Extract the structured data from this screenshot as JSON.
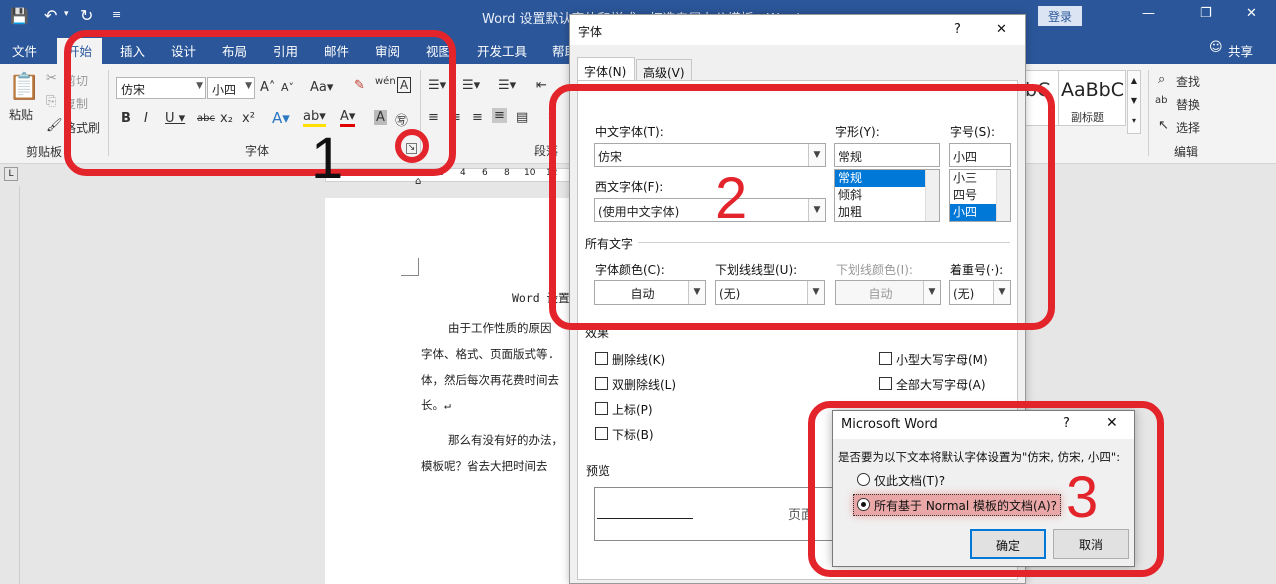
{
  "title": {
    "text": "Word  设置默认字体和样式，打造专属办公模板  -  Word",
    "login_label": "登录",
    "minimize_glyph": "—",
    "restore_glyph": "❐",
    "close_glyph": "✕"
  },
  "tabs": [
    "文件",
    "开始",
    "插入",
    "设计",
    "布局",
    "引用",
    "邮件",
    "审阅",
    "视图",
    "开发工具",
    "帮助"
  ],
  "share_label": "共享",
  "ribbon": {
    "clipboard": {
      "paste": "粘贴",
      "cut": "剪切",
      "copy": "复制",
      "painter": "格式刷",
      "group": "剪贴板"
    },
    "font": {
      "font_name": "仿宋",
      "font_size": "小四",
      "group": "字体"
    },
    "paragraph": {
      "group": "段落"
    },
    "styles": {
      "style1_preview": "AaBbC",
      "style1_name": "副标题",
      "style0_preview": "bC"
    },
    "editing": {
      "find": "查找",
      "replace": "替换",
      "select": "选择",
      "group": "编辑"
    }
  },
  "ruler": {
    "ticks": [
      "2",
      "4",
      "6",
      "8",
      "10",
      "12"
    ]
  },
  "document": {
    "heading": "Word 设置",
    "lines": [
      "由于工作性质的原因",
      "字体、格式、页面版式等.",
      "体，然后每次再花费时间去",
      "长。↵",
      "那么有没有好的办法，",
      "模板呢？省去大把时间去"
    ]
  },
  "font_dialog": {
    "title": "字体",
    "help": "?",
    "close": "✕",
    "tabs": [
      "字体(N)",
      "高级(V)"
    ],
    "chinese_font_label": "中文字体(T):",
    "chinese_font_value": "仿宋",
    "western_font_label": "西文字体(F):",
    "western_font_value": "(使用中文字体)",
    "style_label": "字形(Y):",
    "style_value": "常规",
    "style_options": [
      "常规",
      "倾斜",
      "加粗"
    ],
    "size_label": "字号(S):",
    "size_value": "小四",
    "size_options": [
      "小三",
      "四号",
      "小四"
    ],
    "all_text_label": "所有文字",
    "font_color_label": "字体颜色(C):",
    "font_color_value": "自动",
    "underline_style_label": "下划线线型(U):",
    "underline_style_value": "(无)",
    "underline_color_label": "下划线颜色(I):",
    "underline_color_value": "自动",
    "emphasis_label": "着重号(·):",
    "emphasis_value": "(无)",
    "effects_label": "效果",
    "effects_left": [
      "删除线(K)",
      "双删除线(L)",
      "上标(P)",
      "下标(B)"
    ],
    "effects_right": [
      "小型大写字母(M)",
      "全部大写字母(A)"
    ],
    "preview_label": "预览",
    "preview_text": "页面"
  },
  "ms_dialog": {
    "title": "Microsoft Word",
    "help": "?",
    "close": "✕",
    "question": "是否要为以下文本将默认字体设置为\"仿宋, 仿宋, 小四\":",
    "option1": "仅此文档(T)?",
    "option2": "所有基于 Normal 模板的文档(A)?",
    "ok": "确定",
    "cancel": "取消"
  },
  "annotations": [
    "1",
    "2",
    "3"
  ],
  "colors": {
    "ribbon_blue": "#2b579a",
    "highlight_red": "#e3242b",
    "selection_blue": "#0078d7"
  }
}
